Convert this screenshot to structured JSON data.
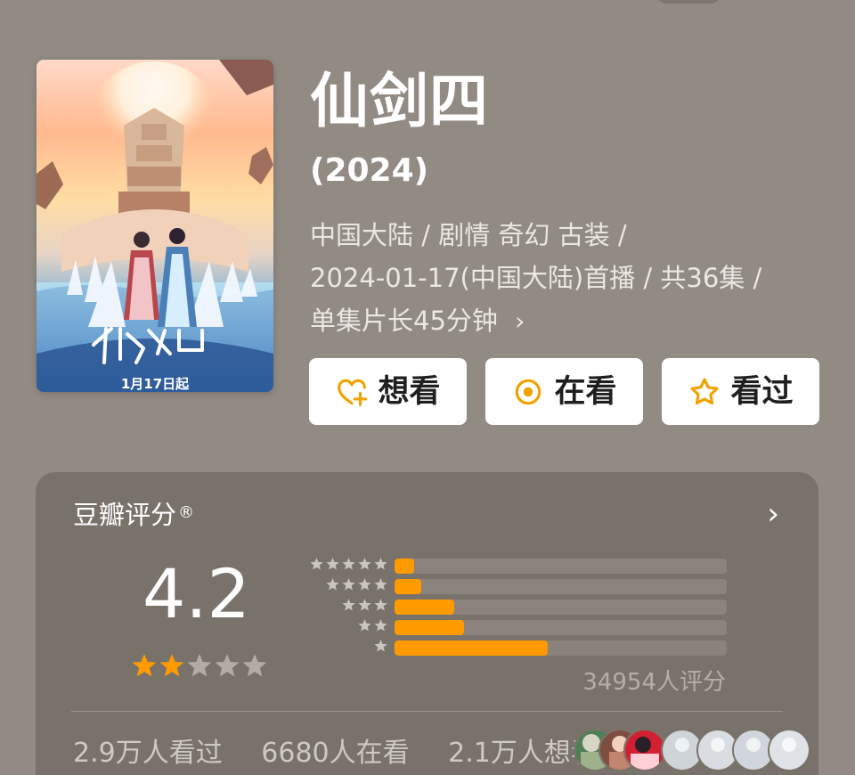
{
  "title": "仙剑四",
  "year": "(2024)",
  "poster": {
    "release_label": "1月17日起"
  },
  "meta": {
    "line1": "中国大陆 / 剧情 奇幻 古装 /",
    "line2": "2024-01-17(中国大陆)首播 / 共36集 /",
    "line3": "单集片长45分钟"
  },
  "actions": {
    "want": "想看",
    "watching": "在看",
    "watched": "看过"
  },
  "rating": {
    "title": "豆瓣评分",
    "registered_mark": "®",
    "score": "4.2",
    "score_stars": {
      "filled": 2,
      "total": 5
    },
    "distribution": [
      {
        "stars": 5,
        "fraction": 0.06
      },
      {
        "stars": 4,
        "fraction": 0.08
      },
      {
        "stars": 3,
        "fraction": 0.18
      },
      {
        "stars": 2,
        "fraction": 0.21
      },
      {
        "stars": 1,
        "fraction": 0.46
      }
    ],
    "count_text": "34954人评分"
  },
  "stats": {
    "watched": "2.9万人看过",
    "watching": "6680人在看",
    "want": "2.1万人想看"
  },
  "colors": {
    "background": "#928b84",
    "card": "#79726b",
    "accent": "#ff9a00",
    "button_bg": "#ffffff",
    "text": "#ffffff"
  },
  "icons": {
    "want": "heart-plus-icon",
    "watching": "target-circle-icon",
    "watched": "star-outline-icon",
    "card_more": "chevron-right-icon"
  }
}
